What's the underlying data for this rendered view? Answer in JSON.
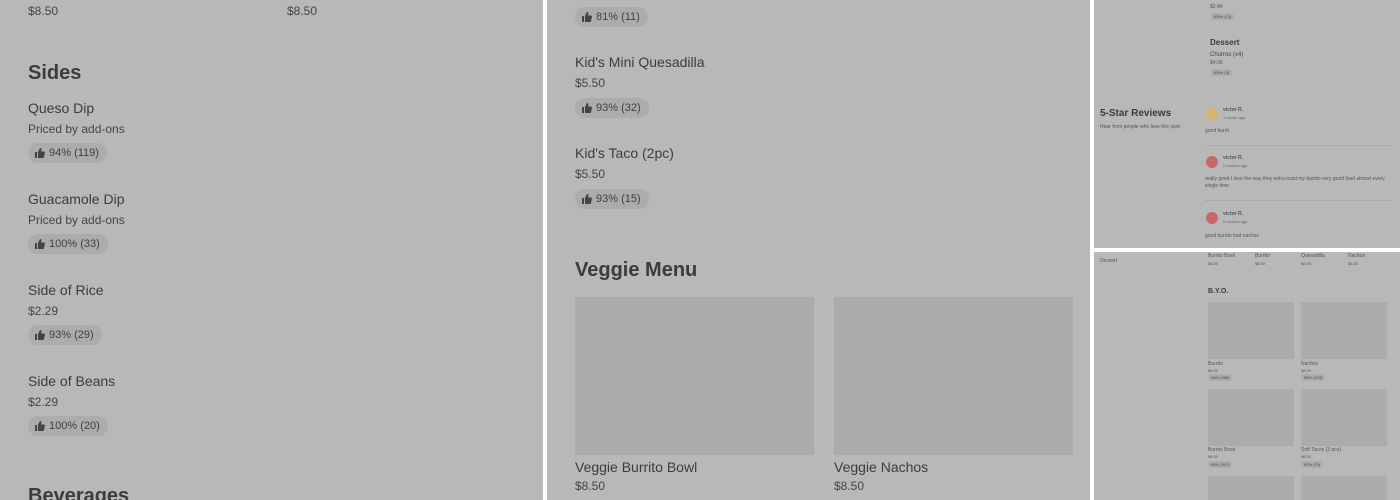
{
  "panel1": {
    "top_price_left": "$8.50",
    "top_price_right": "$8.50",
    "section_title": "Sides",
    "items": [
      {
        "name": "Queso Dip",
        "price": "Priced by add-ons",
        "rating": "94% (119)"
      },
      {
        "name": "Guacamole Dip",
        "price": "Priced by add-ons",
        "rating": "100% (33)"
      },
      {
        "name": "Side of Rice",
        "price": "$2.29",
        "rating": "93% (29)"
      },
      {
        "name": "Side of Beans",
        "price": "$2.29",
        "rating": "100% (20)"
      }
    ],
    "next_section_title": "Beverages"
  },
  "panel2": {
    "top_rating": "81% (11)",
    "items": [
      {
        "name": "Kid's Mini Quesadilla",
        "price": "$5.50",
        "rating": "93% (32)"
      },
      {
        "name": "Kid's Taco (2pc)",
        "price": "$5.50",
        "rating": "93% (15)"
      }
    ],
    "section_title": "Veggie Menu",
    "veggie_items": [
      {
        "name": "Veggie Burrito Bowl",
        "price": "$8.50"
      },
      {
        "name": "Veggie Nachos",
        "price": "$8.50"
      }
    ]
  },
  "panel3": {
    "top_price": "$2.49",
    "top_rating": "100% (13)",
    "dessert_title": "Dessert",
    "dessert_item": {
      "name": "Churros (x4)",
      "price": "$4.00",
      "rating": "100% (3)"
    },
    "reviews_title": "5-Star Reviews",
    "reviews_subtitle": "Hear from people who love this spot",
    "reviews": [
      {
        "author": "victor R.",
        "time": "1 month ago",
        "text": "good burrit",
        "avatar_color": "#d9b46e"
      },
      {
        "author": "victor R.",
        "time": "2 months ago",
        "text": "really good I love the way they extra toast my burrito very good food almost every",
        "text2": "single time",
        "avatar_color": "#c86868"
      },
      {
        "author": "victor R.",
        "time": "6 months ago",
        "text": "good burrito bad nachos",
        "avatar_color": "#c86868"
      }
    ]
  },
  "panel4": {
    "sidebar_label": "Dessert",
    "top_items": [
      {
        "name": "Burrito Bowl",
        "price": "$8.50"
      },
      {
        "name": "Burrito",
        "price": "$8.50"
      },
      {
        "name": "Quesadilla",
        "price": "$8.50"
      },
      {
        "name": "Nachos",
        "price": "$8.50"
      }
    ],
    "section_title": "B.Y.O.",
    "grid_items": [
      {
        "name": "Burrito",
        "price": "$8.50",
        "rating": "98% (389)"
      },
      {
        "name": "Nachos",
        "price": "$8.50",
        "rating": "95% (103)"
      },
      {
        "name": "Burrito Bowl",
        "price": "$8.50",
        "rating": "95% (207)"
      },
      {
        "name": "Soft Tacos (3 pcs)",
        "price": "$8.50",
        "rating": "92% (70)"
      }
    ]
  },
  "colors": {
    "panel_bg": "#b8b8b8",
    "placeholder": "#ababab",
    "pill_bg": "#acacac"
  }
}
